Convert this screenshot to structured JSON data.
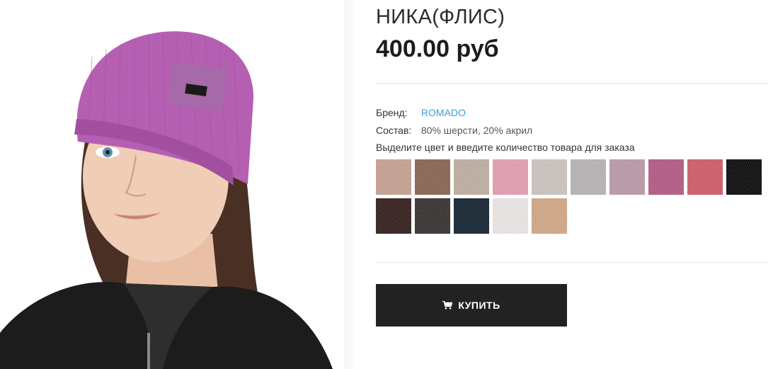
{
  "product": {
    "title": "НИКА(ФЛИС)",
    "price": "400.00 руб"
  },
  "attributes": {
    "brand_label": "Бренд:",
    "brand_value": "ROMADO",
    "composition_label": "Состав:",
    "composition_value": "80% шерсти, 20% акрил"
  },
  "hint": "Выделите цвет и введите количество товара для заказа",
  "swatches": [
    {
      "name": "swatch-1",
      "color": "#c9a596"
    },
    {
      "name": "swatch-2",
      "color": "#8e6a57"
    },
    {
      "name": "swatch-3",
      "color": "#c2b2a7"
    },
    {
      "name": "swatch-4",
      "color": "#e6a2b6"
    },
    {
      "name": "swatch-5",
      "color": "#cfc6c2"
    },
    {
      "name": "swatch-6",
      "color": "#bbb7b8"
    },
    {
      "name": "swatch-7",
      "color": "#bf9dac"
    },
    {
      "name": "swatch-8",
      "color": "#b76089"
    },
    {
      "name": "swatch-9",
      "color": "#d4616f"
    },
    {
      "name": "swatch-10",
      "color": "#141213"
    },
    {
      "name": "swatch-11",
      "color": "#3a2624"
    },
    {
      "name": "swatch-12",
      "color": "#3b3837"
    },
    {
      "name": "swatch-13",
      "color": "#1b2a37"
    },
    {
      "name": "swatch-14",
      "color": "#ece9e8"
    },
    {
      "name": "swatch-15",
      "color": "#d5ab8b"
    }
  ],
  "buy_button": {
    "label": "КУПИТЬ",
    "icon": "cart-icon"
  },
  "colors": {
    "link": "#3aa0d8",
    "button_bg": "#222222"
  }
}
